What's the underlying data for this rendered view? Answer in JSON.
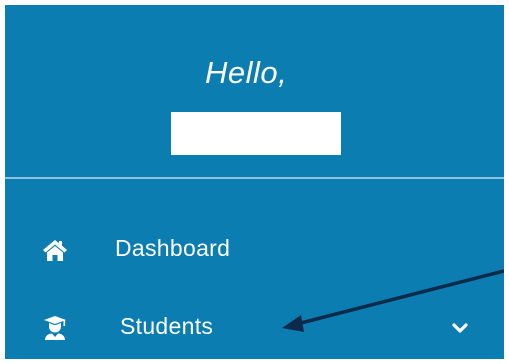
{
  "greeting": {
    "text": "Hello,"
  },
  "nav": {
    "items": [
      {
        "label": "Dashboard",
        "icon": "home-icon"
      },
      {
        "label": "Students",
        "icon": "graduate-icon",
        "expand_icon": "chevron-down-icon"
      }
    ]
  },
  "colors": {
    "sidebar_bg": "#0b7db1",
    "text": "#ffffff",
    "divider": "#8cc3de",
    "annotation_arrow": "#0e2a4a"
  }
}
